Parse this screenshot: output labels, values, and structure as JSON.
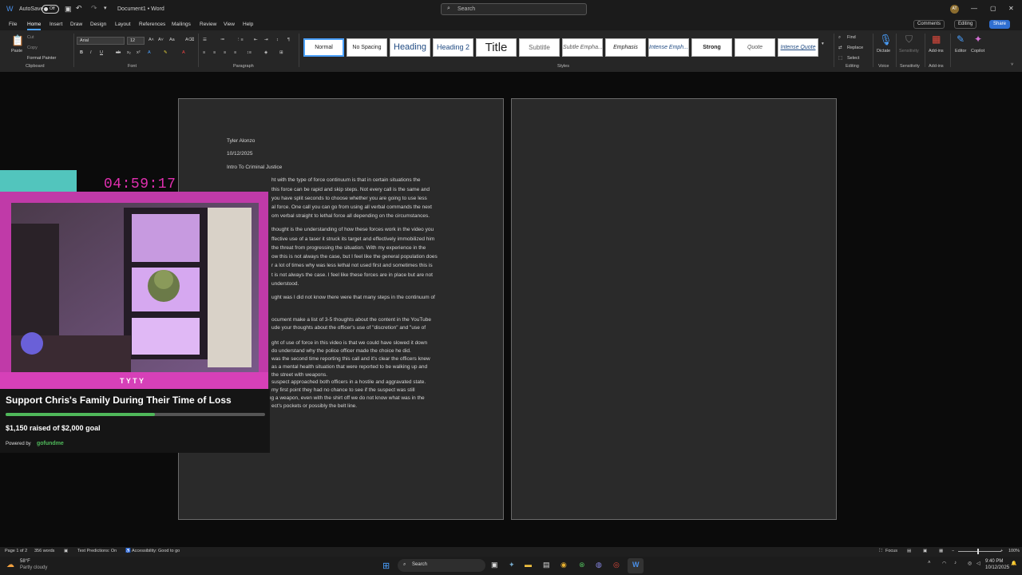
{
  "titlebar": {
    "autosave_label": "AutoSave",
    "autosave_state": "Off",
    "document_title": "Document1 • Word",
    "search_placeholder": "Search",
    "avatar_initials": "AT"
  },
  "menu": {
    "items": [
      "File",
      "Home",
      "Insert",
      "Draw",
      "Design",
      "Layout",
      "References",
      "Mailings",
      "Review",
      "View",
      "Help"
    ],
    "active": "Home",
    "comments_label": "Comments",
    "editing_label": "Editing",
    "share_label": "Share"
  },
  "ribbon": {
    "clipboard": {
      "paste": "Paste",
      "cut": "Cut",
      "copy": "Copy",
      "format_painter": "Format Painter",
      "group": "Clipboard"
    },
    "font": {
      "name": "Arial",
      "size": "12",
      "group": "Font"
    },
    "paragraph": {
      "group": "Paragraph"
    },
    "styles": {
      "items": [
        "Normal",
        "No Spacing",
        "Heading",
        "Heading 2",
        "Title",
        "Subtitle",
        "Subtle Empha...",
        "Emphasis",
        "Intense Emph...",
        "Strong",
        "Quote",
        "Intense Quote"
      ],
      "group": "Styles"
    },
    "editing": {
      "find": "Find",
      "replace": "Replace",
      "select": "Select",
      "group": "Editing"
    },
    "voice": {
      "dictate": "Dictate",
      "group": "Voice"
    },
    "sensitivity": {
      "label": "Sensitivity",
      "group": "Sensitivity"
    },
    "addins": {
      "label": "Add-ins",
      "group": "Add-ins"
    },
    "editor": {
      "label": "Editor"
    },
    "copilot": {
      "label": "Copilot"
    }
  },
  "document": {
    "header_lines": [
      "Tyler Alonzo",
      "10/12/2025",
      "Intro To Criminal Justice"
    ],
    "body_lines": [
      "ht with the type of force continuum is that in certain situations the",
      "this force can be rapid and skip steps. Not every call is the same and",
      "you have split seconds to choose whether you are going to use less",
      "al force. One call you can go from using all verbal commands the next",
      "om verbal straight to lethal force all depending on the circumstances.",
      "thought is the understanding of how these forces work in the video you",
      "ffective use of a taser it struck its target and effectively immobilized him",
      "the threat from progressing the situation. With my experience in the",
      "ow this is not always the case, but I feel like the general population does",
      "r a lot of times why was less lethal not used first and sometimes this is",
      "t is not always the case. I feel like these forces are in place but are not",
      "understood.",
      "ught was I did not know there were that many steps in the continuum of",
      "ocument make a list of 3-5 thoughts about the content in the YouTube",
      "ude your thoughts about the officer's use of \"discretion\" and \"use of",
      "ght of use of force in this video is that we could have slowed it down",
      "do understand why the police officer made the choice he did.",
      "was the second time reporting this call and it's clear the officers knew",
      "as a mental health situation that were reported to be walking up and",
      "the street with weapons.",
      "suspect approached both officers in a hostile and aggravated state.",
      "my first point they had no chance to see if the suspect was still",
      "carrying a weapon, even with the shirt off we do not know what was in the",
      "ect's pockets or possibly the belt line."
    ]
  },
  "overlay": {
    "timer": "04:59:17",
    "campaign_title": "Support Chris's Family During Their Time of Loss",
    "raised_text": "$1,150 raised of $2,000 goal",
    "progress_fraction": 0.575,
    "powered_by": "Powered by",
    "brand": "gofundme"
  },
  "statusbar": {
    "page": "Page 1 of 2",
    "words": "356 words",
    "text_predictions": "Text Predictions: On",
    "accessibility": "Accessibility: Good to go",
    "focus": "Focus",
    "zoom": "100%"
  },
  "taskbar": {
    "weather_temp": "58°F",
    "weather_desc": "Partly cloudy",
    "search": "Search",
    "time": "9:40 PM",
    "date": "10/12/2025"
  },
  "colors": {
    "accent": "#4aa0ff",
    "timer": "#e12fb0",
    "progress": "#4fb85a",
    "share": "#2f6fd1"
  }
}
